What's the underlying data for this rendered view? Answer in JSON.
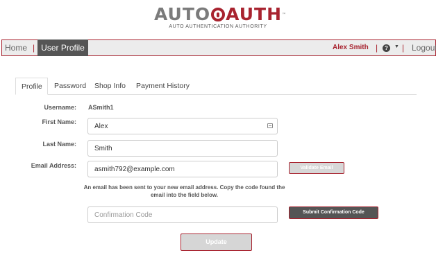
{
  "brand": {
    "logo_part1": "AUTO",
    "logo_part2": "AUTH",
    "logo_tm": "™",
    "tagline": "AUTO AUTHENTICATION AUTHORITY",
    "primary_color": "#a8232f",
    "gray_color": "#7b7b7b"
  },
  "topnav": {
    "home_label": "Home",
    "separator": "|",
    "active_label": "User Profile",
    "user_name": "Alex Smith",
    "help_glyph": "?",
    "caret_glyph": "▼",
    "logout_label": "Logout"
  },
  "tabs": [
    {
      "label": "Profile",
      "active": true
    },
    {
      "label": "Password",
      "active": false
    },
    {
      "label": "Shop Info",
      "active": false
    },
    {
      "label": "Payment History",
      "active": false
    }
  ],
  "form": {
    "username_label": "Username:",
    "username_value": "ASmith1",
    "first_name_label": "First Name:",
    "first_name_value": "Alex",
    "last_name_label": "Last Name:",
    "last_name_value": "Smith",
    "email_label": "Email Address:",
    "email_value": "asmith792@example.com",
    "validate_label": "Validate Email",
    "notice_text": "An email has been sent to your new email address. Copy the code found the email into the field below.",
    "confirmation_placeholder": "Confirmation Code",
    "submit_code_label": "Submit Confirmation Code",
    "update_label": "Update"
  }
}
